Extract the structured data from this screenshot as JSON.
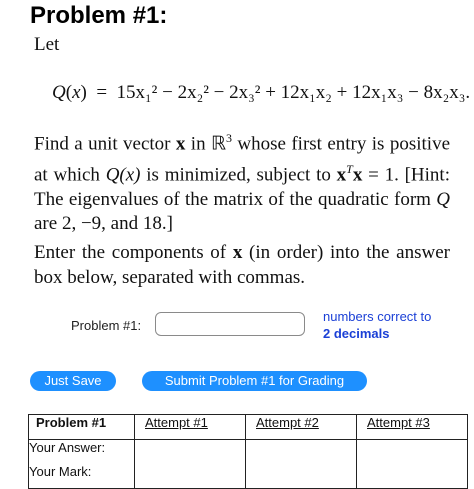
{
  "problem": {
    "heading": "Problem #1:",
    "let": "Let",
    "equation": {
      "lhs": "Q(x)",
      "equals": "=",
      "rhs_text": "15x₁² − 2x₂² − 2x₃² + 12x₁x₂ + 12x₁x₃ − 8x₂x₃."
    },
    "paragraph1": {
      "t1": "Find a unit vector ",
      "x": "x",
      "t2": " in ℝ",
      "dim": "3",
      "t3": " whose first entry is positive at which ",
      "qx": "Q(x)",
      "t4": " is minimized, subject to ",
      "xt": "x",
      "T": "T",
      "x2": "x",
      "t5": " = 1. [Hint: The eigenvalues of the matrix of the quadratic form ",
      "q": "Q",
      "t6": " are 2, −9, and 18.]"
    },
    "paragraph2": {
      "t1": "Enter the components of ",
      "x": "x",
      "t2": " (in order) into the answer box below, separated with commas."
    }
  },
  "answer": {
    "label": "Problem #1:",
    "value": "",
    "hint_line1": "numbers correct to",
    "hint_line2": "2 decimals"
  },
  "buttons": {
    "save": "Just Save",
    "submit": "Submit Problem #1 for Grading"
  },
  "attempts_table": {
    "header": "Problem #1",
    "attempts": [
      "Attempt #1",
      "Attempt #2",
      "Attempt #3"
    ],
    "rows": [
      "Your Answer:",
      "Your Mark:"
    ]
  },
  "colors": {
    "button_bg": "#1e90ff",
    "hint_text": "#1a3fd6"
  }
}
